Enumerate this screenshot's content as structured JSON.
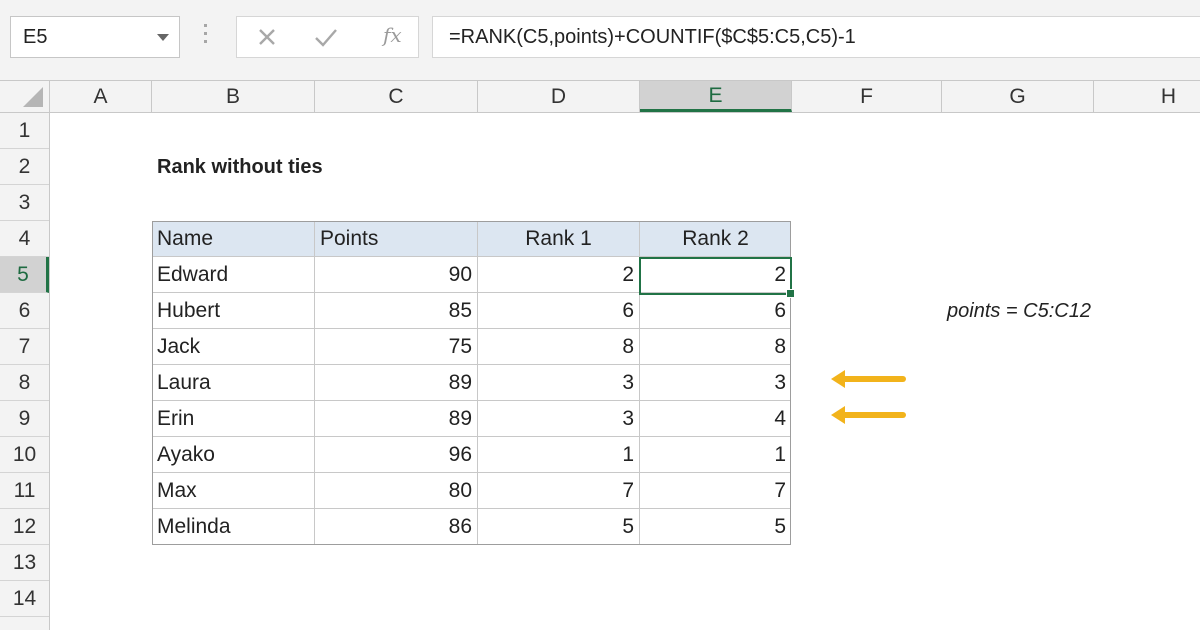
{
  "name_box": {
    "value": "E5"
  },
  "formula_bar": {
    "formula": "=RANK(C5,points)+COUNTIF($C$5:C5,C5)-1",
    "fx_label": "fx"
  },
  "columns": [
    "A",
    "B",
    "C",
    "D",
    "E",
    "F",
    "G",
    "H"
  ],
  "active_column": "E",
  "rows": [
    "1",
    "2",
    "3",
    "4",
    "5",
    "6",
    "7",
    "8",
    "9",
    "10",
    "11",
    "12",
    "13",
    "14"
  ],
  "active_row": "5",
  "sheet": {
    "title": "Rank without ties",
    "named_range_note": "points = C5:C12",
    "table": {
      "headers": [
        "Name",
        "Points",
        "Rank 1",
        "Rank 2"
      ],
      "rows": [
        [
          "Edward",
          "90",
          "2",
          "2"
        ],
        [
          "Hubert",
          "85",
          "6",
          "6"
        ],
        [
          "Jack",
          "75",
          "8",
          "8"
        ],
        [
          "Laura",
          "89",
          "3",
          "3"
        ],
        [
          "Erin",
          "89",
          "3",
          "4"
        ],
        [
          "Ayako",
          "96",
          "1",
          "1"
        ],
        [
          "Max",
          "80",
          "7",
          "7"
        ],
        [
          "Melinda",
          "86",
          "5",
          "5"
        ]
      ]
    }
  },
  "selected_cell": "E5",
  "arrows_rows": [
    "8",
    "9"
  ],
  "colors": {
    "accent": "#217346",
    "header_fill": "#dce6f1",
    "arrow": "#f2b31b"
  },
  "icons": [
    "chevron-down-icon",
    "cancel-x-icon",
    "enter-check-icon",
    "insert-function-icon"
  ]
}
